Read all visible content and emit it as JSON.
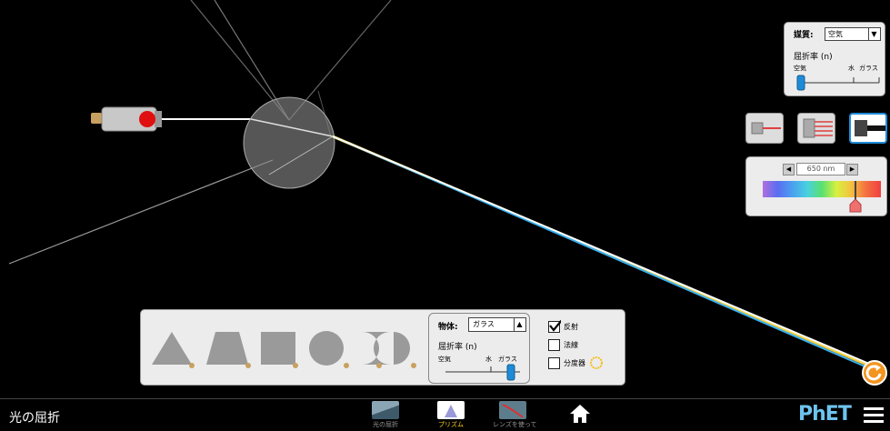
{
  "app": {
    "title": "光の屈折"
  },
  "medium_panel": {
    "label": "媒質:",
    "selected": "空気",
    "index_label": "屈折率 (n)",
    "ticks": [
      "空気",
      "水",
      "ガラス"
    ]
  },
  "light_modes": {
    "options": [
      "single-ray",
      "multiple-rays",
      "white-light"
    ],
    "selected": "white-light"
  },
  "wavelength": {
    "value": "650 nm"
  },
  "object_panel": {
    "label": "物体:",
    "selected": "ガラス",
    "index_label": "屈折率 (n)",
    "ticks": [
      "空気",
      "水",
      "ガラス"
    ],
    "shapes": [
      "triangle",
      "trapezoid",
      "square",
      "circle",
      "semicircle"
    ]
  },
  "options": {
    "reflections": {
      "label": "反射",
      "checked": true
    },
    "normal": {
      "label": "法線",
      "checked": false
    },
    "protractor": {
      "label": "分度器",
      "checked": false
    }
  },
  "nav": {
    "screens": [
      {
        "label": "光の屈折",
        "selected": false
      },
      {
        "label": "プリズム",
        "selected": true
      },
      {
        "label": "レンズを使って",
        "selected": false
      }
    ],
    "brand": "PhET"
  },
  "colors": {
    "accent": "#1e8bd8",
    "reset": "#f3941e",
    "nav_selected": "#ffd21e",
    "brand": "#6ec3ee"
  }
}
